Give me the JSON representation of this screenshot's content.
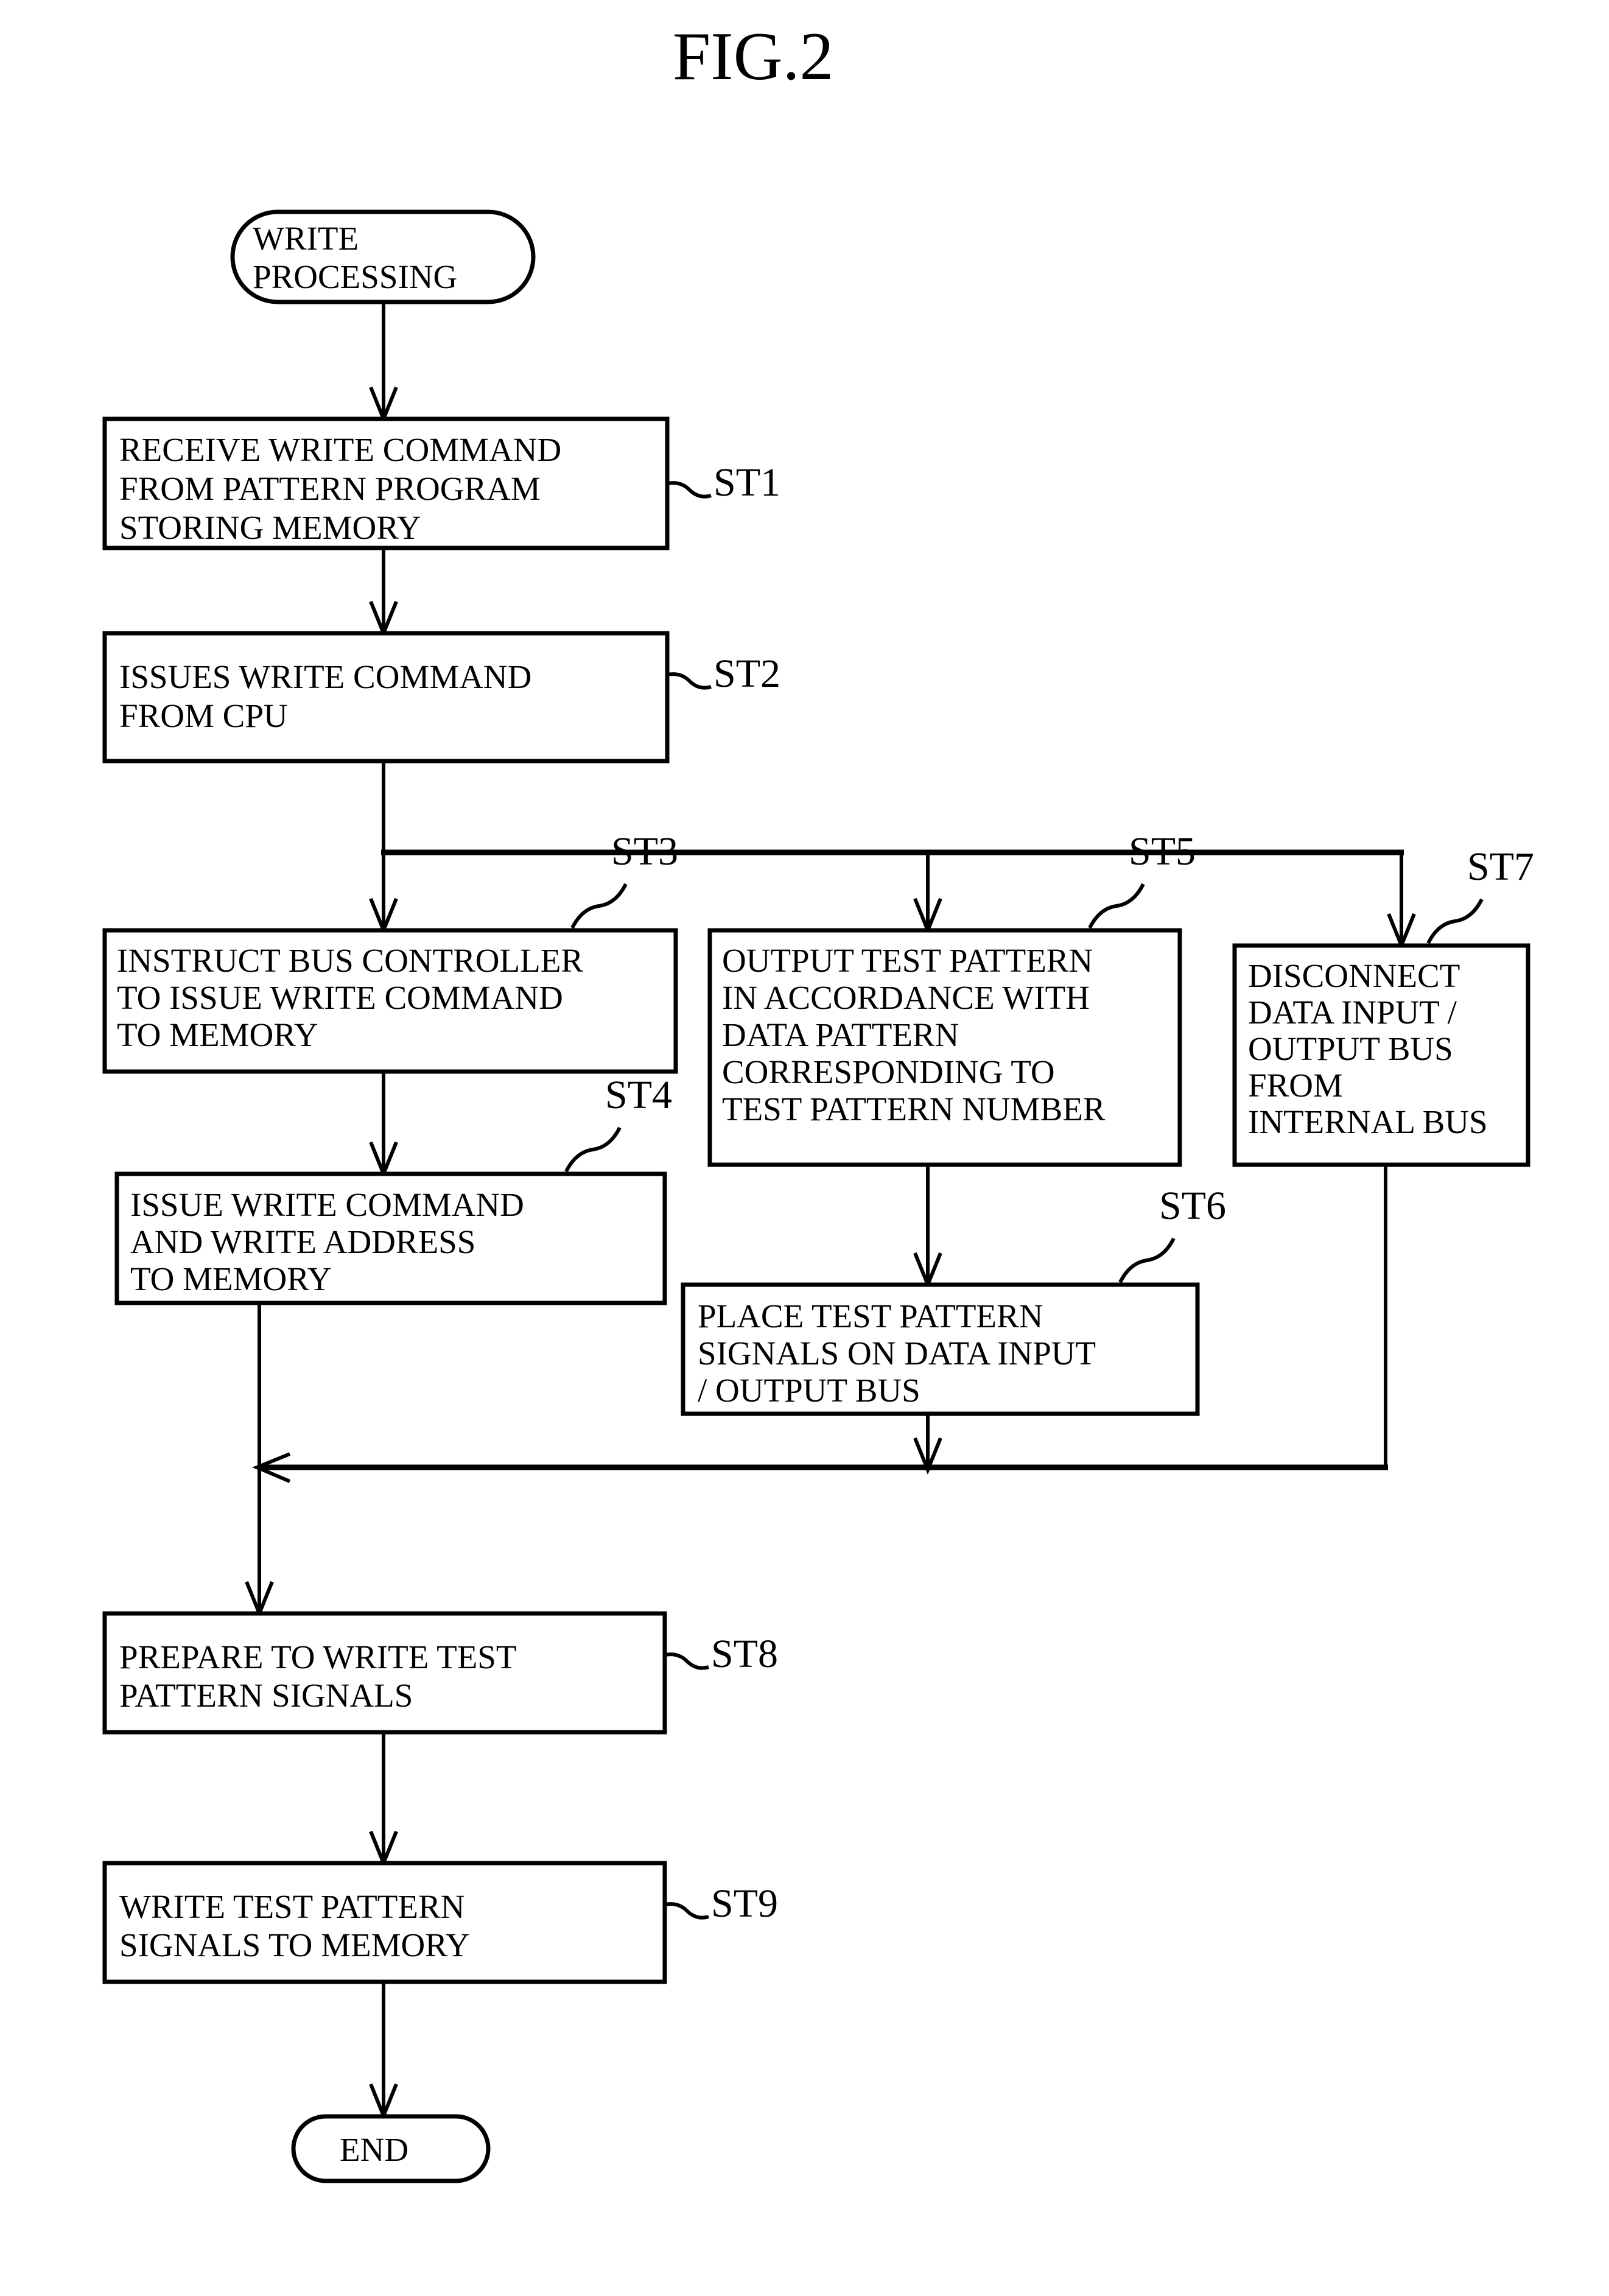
{
  "figure": {
    "title": "FIG.2",
    "type": "flowchart",
    "orientation": "top-to-bottom"
  },
  "terminals": {
    "start": {
      "id": "start-terminal",
      "lines": [
        "WRITE",
        "PROCESSING"
      ],
      "shape": "stadium"
    },
    "end": {
      "id": "end-terminal",
      "lines": [
        "END"
      ],
      "shape": "stadium"
    }
  },
  "steps": [
    {
      "id": "ST1",
      "label": "ST1",
      "lines": [
        "RECEIVE WRITE COMMAND",
        "FROM PATTERN PROGRAM",
        "STORING MEMORY"
      ]
    },
    {
      "id": "ST2",
      "label": "ST2",
      "lines": [
        "ISSUES WRITE COMMAND",
        "FROM CPU"
      ]
    },
    {
      "id": "ST3",
      "label": "ST3",
      "lines": [
        "INSTRUCT BUS CONTROLLER",
        "TO ISSUE WRITE COMMAND",
        "TO MEMORY"
      ]
    },
    {
      "id": "ST4",
      "label": "ST4",
      "lines": [
        "ISSUE WRITE COMMAND",
        "AND WRITE ADDRESS",
        "TO MEMORY"
      ]
    },
    {
      "id": "ST5",
      "label": "ST5",
      "lines": [
        "OUTPUT TEST PATTERN",
        "IN ACCORDANCE WITH",
        "DATA PATTERN",
        "CORRESPONDING TO",
        "TEST PATTERN NUMBER"
      ]
    },
    {
      "id": "ST6",
      "label": "ST6",
      "lines": [
        "PLACE TEST PATTERN",
        "SIGNALS ON DATA INPUT",
        "/ OUTPUT BUS"
      ]
    },
    {
      "id": "ST7",
      "label": "ST7",
      "lines": [
        "DISCONNECT",
        "DATA INPUT /",
        "OUTPUT BUS",
        "FROM",
        "INTERNAL BUS"
      ]
    },
    {
      "id": "ST8",
      "label": "ST8",
      "lines": [
        "PREPARE TO WRITE TEST",
        "PATTERN SIGNALS"
      ]
    },
    {
      "id": "ST9",
      "label": "ST9",
      "lines": [
        "WRITE TEST PATTERN",
        "SIGNALS TO MEMORY"
      ]
    }
  ],
  "colors": {
    "line": "#000000",
    "fill": "#ffffff",
    "text": "#000000"
  }
}
